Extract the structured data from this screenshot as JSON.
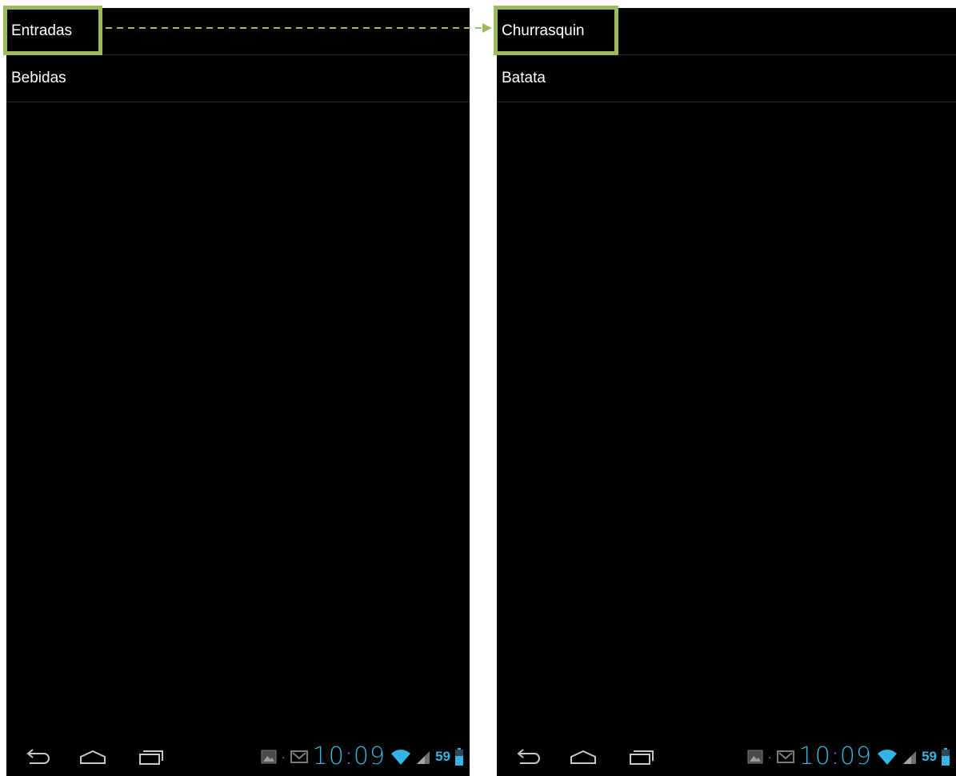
{
  "screens": [
    {
      "list": [
        "Entradas",
        "Bebidas"
      ],
      "status": {
        "time": "10:09",
        "battery": "59"
      }
    },
    {
      "list": [
        "Churrasquin",
        "Batata"
      ],
      "status": {
        "time": "10:09",
        "battery": "59"
      }
    }
  ],
  "icons": {
    "back": "back-icon",
    "home": "home-icon",
    "recents": "recent-apps-icon",
    "gallery": "gallery-notification-icon",
    "gmail": "gmail-notification-icon",
    "wifi": "wifi-icon",
    "signal": "signal-icon",
    "battery": "battery-icon"
  },
  "colors": {
    "screen_background": "#000000",
    "list_text": "#ffffff",
    "highlight_border": "#9cbb5c",
    "status_accent": "#33b5e5"
  }
}
